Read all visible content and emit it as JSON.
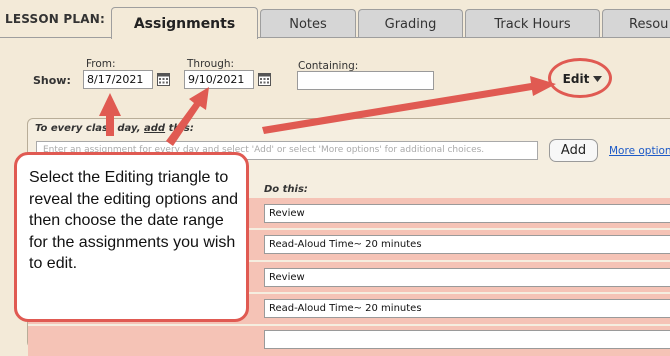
{
  "tabbar": {
    "section_label": "LESSON PLAN:",
    "tabs": [
      {
        "label": "Assignments",
        "active": true
      },
      {
        "label": "Notes",
        "active": false
      },
      {
        "label": "Grading",
        "active": false
      },
      {
        "label": "Track Hours",
        "active": false
      },
      {
        "label": "Resou",
        "active": false
      }
    ]
  },
  "filter": {
    "show_label": "Show:",
    "from_label": "From:",
    "from_value": "8/17/2021",
    "through_label": "Through:",
    "through_value": "9/10/2021",
    "containing_label": "Containing:",
    "containing_value": ""
  },
  "edit": {
    "label": "Edit",
    "icon": "triangle-down-icon"
  },
  "add_row": {
    "label_prefix": "To every class day, ",
    "label_link": "add",
    "label_suffix": " this:",
    "placeholder": "Enter an assignment for every day and select 'Add' or select 'More options' for additional choices.",
    "add_button": "Add",
    "more_options": "More options"
  },
  "list": {
    "do_this_label": "Do this:",
    "rows": [
      {
        "value": "Review"
      },
      {
        "value": "Read-Aloud Time~ 20 minutes"
      },
      {
        "value": "Review"
      },
      {
        "value": "Read-Aloud Time~ 20 minutes"
      },
      {
        "value": ""
      }
    ]
  },
  "callout": {
    "text": "Select the Editing triangle to reveal the editing options and then choose the date range for the assignments you wish to edit."
  },
  "colors": {
    "background": "#f3ead8",
    "annotation_red": "#e05a52",
    "row_highlight": "#f5c3b6",
    "link_blue": "#1d5ac7"
  }
}
